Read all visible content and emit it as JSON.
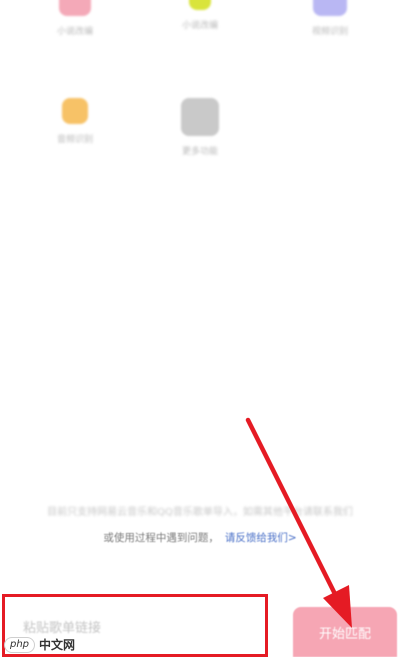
{
  "apps": [
    {
      "label": "小说改编",
      "icon": "pink-app-icon",
      "color": "#f4a9b8"
    },
    {
      "label": "小说改编",
      "icon": "lime-app-icon",
      "color": "#d9e43b"
    },
    {
      "label": "视频识别",
      "icon": "blue-app-icon",
      "color": "#b9b7f3"
    },
    {
      "label": "音频识别",
      "icon": "orange-app-icon",
      "color": "#f7c267"
    },
    {
      "label": "更多功能",
      "icon": "grey-app-icon",
      "color": "#c9c9c9"
    }
  ],
  "notice": {
    "line1": "目前只支持网易云音乐和QQ音乐歌单导入，如需其他平台请联系我们",
    "line2_prefix": "或使用过程中遇到问题，",
    "feedback_link": "请反馈给我们>"
  },
  "input": {
    "placeholder": "粘贴歌单链接"
  },
  "start_button": {
    "label": "开始匹配"
  },
  "watermark": {
    "badge": "php",
    "text": "中文网"
  },
  "colors": {
    "accent_pink": "#f6a6b4",
    "annotation_red": "#e51b24",
    "link_blue": "#4a70c7"
  }
}
